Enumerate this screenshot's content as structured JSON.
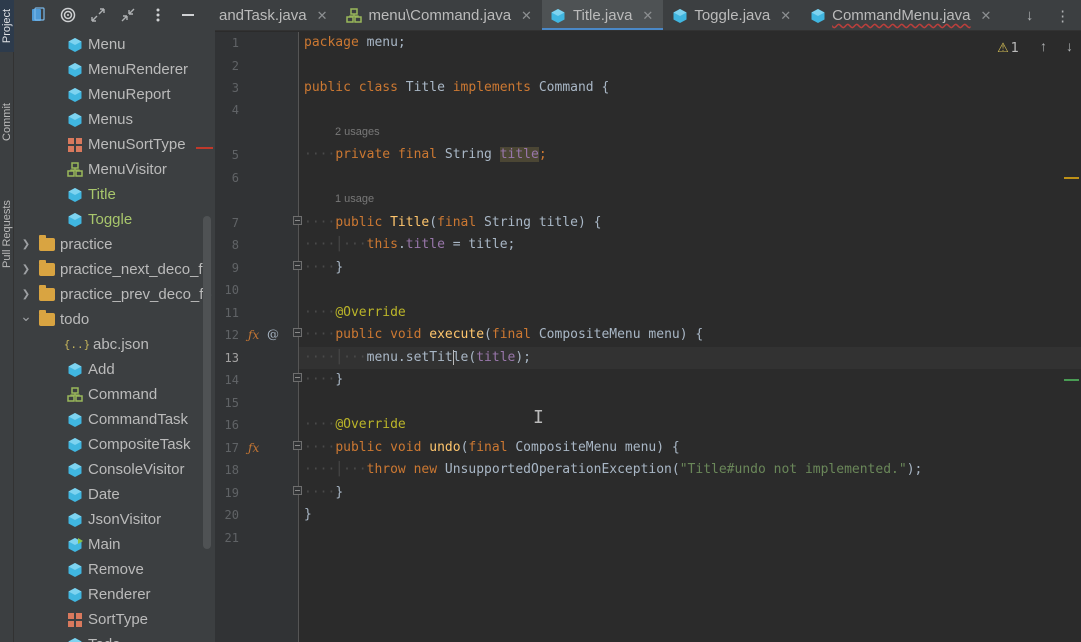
{
  "side_tabs": {
    "project": "Project",
    "commit": "Commit",
    "pull_requests": "Pull Requests"
  },
  "project_toolbar": {
    "icons": [
      "select-opened-file-icon",
      "locate-icon",
      "expand-all-icon",
      "collapse-all-icon",
      "options-icon",
      "hide-icon"
    ]
  },
  "tree": [
    {
      "label": "Menu",
      "type": "class",
      "indent": 2
    },
    {
      "label": "MenuRenderer",
      "type": "class",
      "indent": 2
    },
    {
      "label": "MenuReport",
      "type": "class",
      "indent": 2
    },
    {
      "label": "Menus",
      "type": "class",
      "indent": 2
    },
    {
      "label": "MenuSortType",
      "type": "enum",
      "indent": 2
    },
    {
      "label": "MenuVisitor",
      "type": "interface",
      "indent": 2
    },
    {
      "label": "Title",
      "type": "class",
      "indent": 2,
      "color": "green"
    },
    {
      "label": "Toggle",
      "type": "class",
      "indent": 2,
      "color": "green"
    },
    {
      "label": "practice",
      "type": "folder",
      "indent": 1,
      "collapsed": true
    },
    {
      "label": "practice_next_deco_fo",
      "type": "folder",
      "indent": 1,
      "collapsed": true
    },
    {
      "label": "practice_prev_deco_fo",
      "type": "folder",
      "indent": 1,
      "collapsed": true
    },
    {
      "label": "todo",
      "type": "folder",
      "indent": 1,
      "collapsed": false
    },
    {
      "label": "abc.json",
      "type": "json",
      "indent": 2
    },
    {
      "label": "Add",
      "type": "class",
      "indent": 2
    },
    {
      "label": "Command",
      "type": "interface",
      "indent": 2
    },
    {
      "label": "CommandTask",
      "type": "class",
      "indent": 2
    },
    {
      "label": "CompositeTask",
      "type": "class",
      "indent": 2
    },
    {
      "label": "ConsoleVisitor",
      "type": "class",
      "indent": 2
    },
    {
      "label": "Date",
      "type": "class",
      "indent": 2
    },
    {
      "label": "JsonVisitor",
      "type": "class",
      "indent": 2
    },
    {
      "label": "Main",
      "type": "main",
      "indent": 2
    },
    {
      "label": "Remove",
      "type": "class",
      "indent": 2
    },
    {
      "label": "Renderer",
      "type": "class",
      "indent": 2
    },
    {
      "label": "SortType",
      "type": "enum",
      "indent": 2
    },
    {
      "label": "Todo",
      "type": "class",
      "indent": 2
    }
  ],
  "tabs": [
    {
      "label": "andTask.java",
      "icon": "class",
      "active": false,
      "error": false
    },
    {
      "label": "menu\\Command.java",
      "icon": "interface",
      "active": false,
      "error": false
    },
    {
      "label": "Title.java",
      "icon": "class",
      "active": true,
      "error": false
    },
    {
      "label": "Toggle.java",
      "icon": "class",
      "active": false,
      "error": false
    },
    {
      "label": "CommandMenu.java",
      "icon": "class",
      "active": false,
      "error": true
    }
  ],
  "tab_actions": {
    "down_icon": "↓",
    "more_icon": "⋮"
  },
  "inspections": {
    "warning_count": "1"
  },
  "code": {
    "current_line": 13,
    "line_numbers": [
      "1",
      "2",
      "3",
      "4",
      "5",
      "6",
      "7",
      "8",
      "9",
      "10",
      "11",
      "12",
      "13",
      "14",
      "15",
      "16",
      "17",
      "18",
      "19",
      "20",
      "21"
    ],
    "hints": {
      "line5": "2 usages",
      "line7": "1 usage"
    },
    "tokens": {
      "package": "package",
      "pkg_name": " menu;",
      "public": "public",
      "class": "class",
      "class_name": " Title ",
      "implements": "implements",
      "iface": " Command {",
      "private": "private",
      "final": "final",
      "string": " String ",
      "title": "title",
      "semicolon": ";",
      "ctor": "Title",
      "ctor_params_a": "(",
      "ctor_params_b": " String title) {",
      "this": "this",
      "dot": ".",
      "assign": " = title;",
      "close_brace": "}",
      "override": "@Override",
      "void": "void",
      "execute": "execute",
      "exec_params_b": " CompositeMenu menu) {",
      "menu_dot": "menu.",
      "set_title_a": "setTit",
      "set_title_b": "le",
      "call_args": "(title);",
      "undo": "undo",
      "undo_params_b": " CompositeMenu menu) {",
      "throw": "throw",
      "new": "new",
      "exception": " UnsupportedOperationException(",
      "message": "\"Title#undo not implemented.\"",
      "end_call": ");"
    }
  }
}
